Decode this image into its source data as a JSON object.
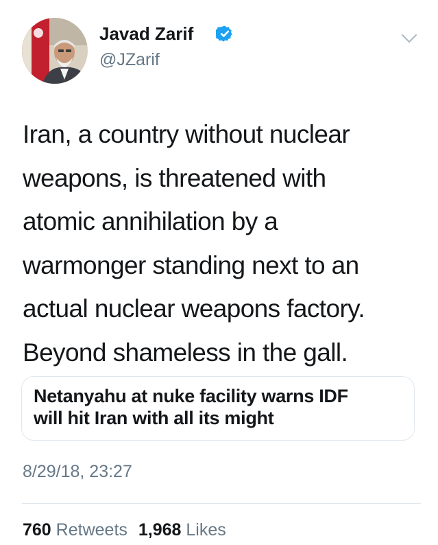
{
  "author": {
    "display_name": "Javad Zarif",
    "handle": "@JZarif",
    "verified": true
  },
  "tweet": {
    "lines": [
      "Iran, a country without nuclear",
      "weapons, is threatened with",
      "atomic annihilation by a",
      "warmonger standing next to an",
      "actual nuclear weapons factory.",
      "Beyond shameless in the gall."
    ]
  },
  "card": {
    "title_lines": [
      "Netanyahu at nuke facility warns IDF",
      "will hit Iran with all its might"
    ]
  },
  "timestamp": "8/29/18, 23:27",
  "stats": {
    "retweets_count": "760",
    "retweets_label": "Retweets",
    "likes_count": "1,968",
    "likes_label": "Likes"
  },
  "icons": {
    "verified": "verified-badge-icon",
    "caret": "chevron-down-icon"
  },
  "colors": {
    "verified_blue": "#1da1f2",
    "secondary_text": "#657786",
    "primary_text": "#14171a",
    "border": "#e1e8ed"
  }
}
